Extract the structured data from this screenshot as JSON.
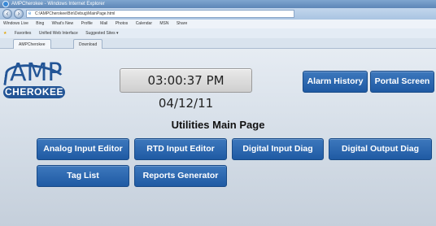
{
  "browser": {
    "window_title": "AMPCherokee - Windows Internet Explorer",
    "url": "C:\\AMPCherokee\\Bin\\Debug\\MainPage.html",
    "command_bar": [
      "Windows Live",
      "Bing",
      "What's New",
      "Profile",
      "Mail",
      "Photos",
      "Calendar",
      "MSN",
      "Share"
    ],
    "favorites_bar": [
      "Favorites",
      "Unified Web Interface",
      "Suggested Sites ▾"
    ],
    "tabs": [
      "AMPCherokee",
      "Download"
    ]
  },
  "logo": {
    "top_text": "AMP",
    "bottom_text": "CHEROKEE",
    "color": "#235596"
  },
  "clock": {
    "text": "03:00:37 PM 04/12/11"
  },
  "header_buttons": {
    "alarm_history": "Alarm History",
    "portal_screen": "Portal Screen"
  },
  "page_title": "Utilities Main Page",
  "utility_buttons": {
    "analog_input_editor": "Analog Input Editor",
    "rtd_input_editor": "RTD Input Editor",
    "digital_input_diag": "Digital Input Diag",
    "digital_output_diag": "Digital Output Diag",
    "tag_list": "Tag List",
    "reports_generator": "Reports Generator"
  },
  "colors": {
    "button_blue": "#2d67b0",
    "page_background": "#d9e1ea"
  }
}
